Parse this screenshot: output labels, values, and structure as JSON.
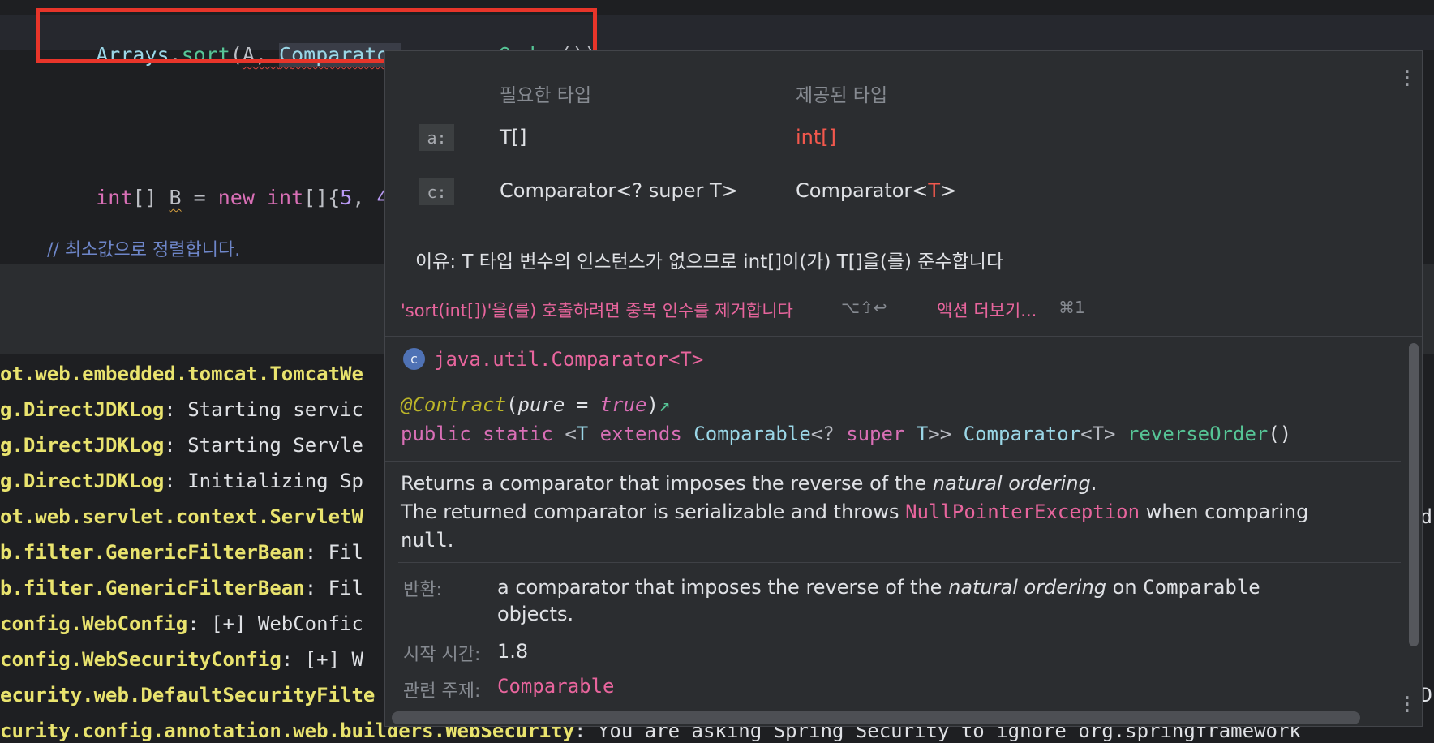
{
  "editor": {
    "line1": {
      "arrays": "Arrays",
      "dot1": ".",
      "sort": "sort",
      "open": "(",
      "arg_a": "A",
      "comma": ", ",
      "comparator_c": "C",
      "comparator_rest": "omparator",
      "dot2": ".",
      "reverse": "reverseOrder",
      "close": "());"
    },
    "line2": {
      "type": "int",
      "brackets": "[] ",
      "var": "B",
      "eq": " = ",
      "new_kw": "new",
      "sp": " ",
      "type2": "int",
      "init_open": "[]{",
      "n5": "5",
      "c1": ", ",
      "n4": "4",
      "c2": ","
    },
    "comment": "// 최소값으로 정렬합니다."
  },
  "console": {
    "lines": [
      {
        "cls": "ot.web.embedded.tomcat.TomcatWe",
        "msg": ""
      },
      {
        "cls": "g.DirectJDKLog",
        "msg": ": Starting servic"
      },
      {
        "cls": "g.DirectJDKLog",
        "msg": ": Starting Servle"
      },
      {
        "cls": "g.DirectJDKLog",
        "msg": ": Initializing Sp"
      },
      {
        "cls": "ot.web.servlet.context.ServletW",
        "msg": ""
      },
      {
        "cls": "b.filter.GenericFilterBean",
        "msg": ": Fil"
      },
      {
        "cls": "b.filter.GenericFilterBean",
        "msg": ": Fil"
      },
      {
        "cls": "config.WebConfig",
        "msg": ": [+] WebConfic"
      },
      {
        "cls": "config.WebSecurityConfig",
        "msg": ": [+] W"
      },
      {
        "cls": "ecurity.web.DefaultSecurityFilte",
        "msg": ""
      },
      {
        "cls": "curity.config.annotation.web.builders.WebSecurity",
        "msg": ": You are asking Spring Security to ignore org.springframework"
      }
    ],
    "right_fragments": {
      "r5": "d",
      "r10": "D"
    }
  },
  "popup": {
    "header_required": "필요한 타입",
    "header_provided": "제공된 타입",
    "rows": [
      {
        "tag": "a:",
        "required": "T[]",
        "provided": "int[]"
      },
      {
        "tag": "c:",
        "required": "Comparator<? super T>",
        "provided_prefix": "Comparator<",
        "provided_t": "T",
        "provided_suffix": ">"
      }
    ],
    "reason": "이유: T 타입 변수의 인스턴스가 없으므로 int[]이(가) T[]을(를) 준수합니다",
    "fix_label": "'sort(int[])'을(를) 호출하려면 중복 인수를 제거합니다",
    "fix_shortcut": "⌥⇧↩",
    "more_actions_label": "액션 더보기...",
    "more_actions_shortcut": "⌘1",
    "doc": {
      "badge": "c",
      "class_name": "java.util.Comparator<T>",
      "annotation": "@Contract",
      "annotation_args_open": "(",
      "annotation_pure": "pure",
      "annotation_eq": " = ",
      "annotation_true": "true",
      "annotation_close": ")",
      "annotation_arrow": "↗",
      "sig_public": "public",
      "sig_static": "static",
      "sig_lt": "<",
      "sig_T1": "T",
      "sig_extends": "extends",
      "sig_comparable": "Comparable",
      "sig_q": "<? ",
      "sig_super": "super",
      "sig_T2": "T",
      "sig_gtgt": ">> ",
      "sig_comparator": "Comparator",
      "sig_ltT": "<T>",
      "sig_method": "reverseOrder",
      "sig_parens": "()",
      "desc1_a": "Returns a comparator that imposes the reverse of the ",
      "desc1_i": "natural ordering",
      "desc1_b": ".",
      "desc2_a": "The returned comparator is serializable and throws ",
      "desc2_code": "NullPointerException",
      "desc2_b": " when comparing",
      "desc3_code": "null",
      "desc3_b": ".",
      "returns_label": "반환:",
      "returns_a": "a comparator that imposes the reverse of the ",
      "returns_i": "natural ordering",
      "returns_b": " on ",
      "returns_code": "Comparable",
      "returns_c": "objects.",
      "since_label": "시작 시간:",
      "since_value": "1.8",
      "see_label": "관련 주제:",
      "see_value": "Comparable"
    }
  }
}
